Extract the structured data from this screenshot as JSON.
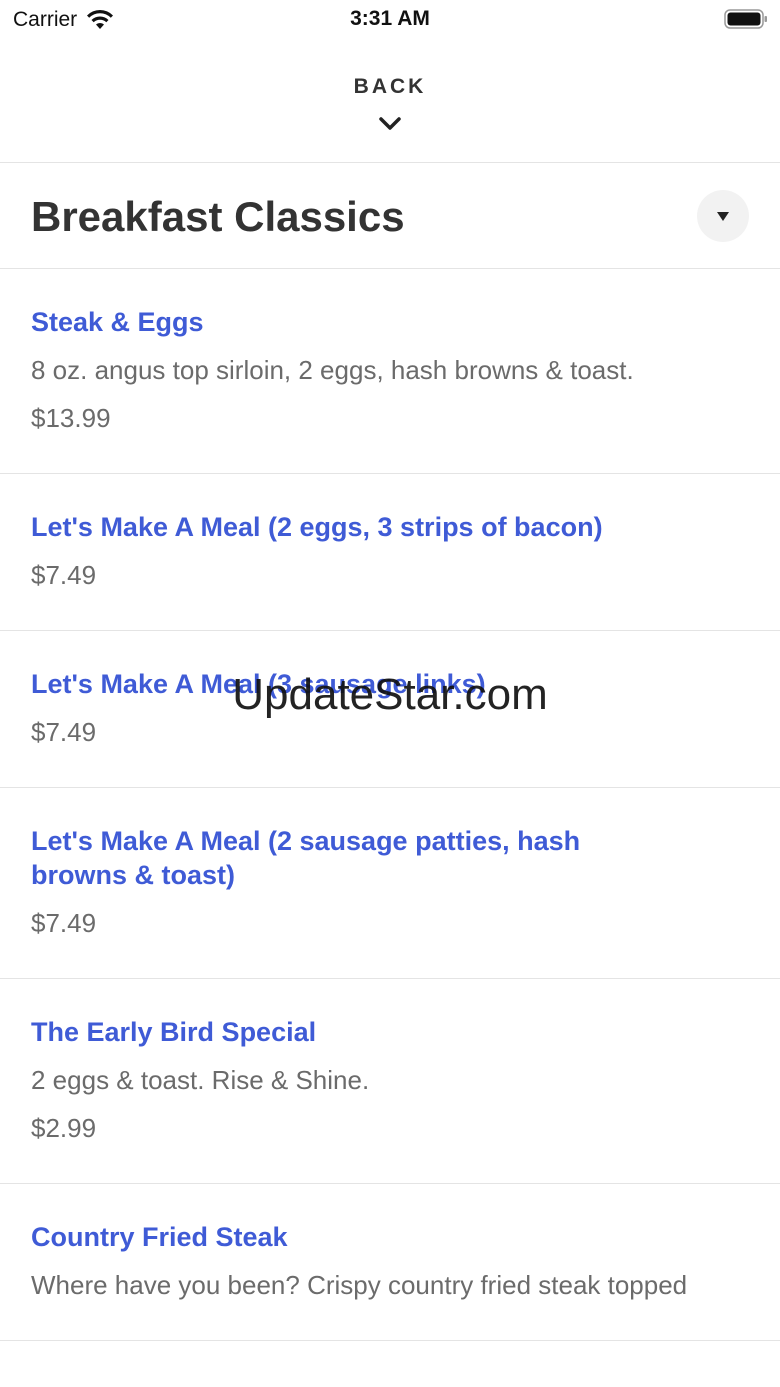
{
  "status_bar": {
    "carrier": "Carrier",
    "time": "3:31 AM"
  },
  "nav": {
    "back_label": "BACK"
  },
  "section": {
    "title": "Breakfast Classics"
  },
  "menu": {
    "items": [
      {
        "name": "Steak & Eggs",
        "description": "8 oz. angus top sirloin, 2 eggs, hash browns & toast.",
        "price": "$13.99"
      },
      {
        "name": "Let's Make A Meal (2 eggs, 3 strips of bacon)",
        "description": "",
        "price": "$7.49"
      },
      {
        "name": "Let's Make A Meal (3 sausage links)",
        "description": "",
        "price": "$7.49"
      },
      {
        "name": "Let's Make A Meal (2 sausage patties, hash browns & toast)",
        "description": "",
        "price": "$7.49"
      },
      {
        "name": "The Early Bird Special",
        "description": "2 eggs & toast. Rise & Shine.",
        "price": "$2.99"
      },
      {
        "name": "Country Fried Steak",
        "description": "Where have you been? Crispy country fried steak topped",
        "price": ""
      }
    ]
  },
  "watermark": "UpdateStar.com",
  "colors": {
    "item_name": "#3f5bd6",
    "secondary_text": "#6b6b6b",
    "divider": "#e4e4e4"
  }
}
